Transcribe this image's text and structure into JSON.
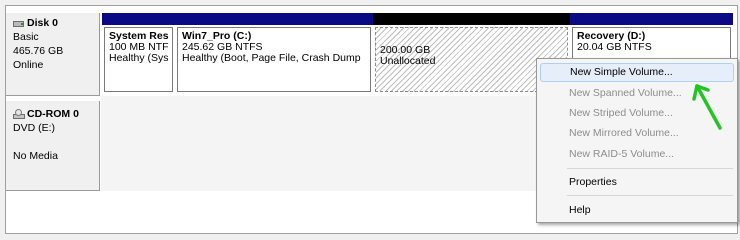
{
  "disk0": {
    "title": "Disk 0",
    "type": "Basic",
    "size": "465.76 GB",
    "status": "Online",
    "partitions": [
      {
        "name": "System Res",
        "size": "100 MB NTF",
        "status": "Healthy (Sys",
        "bar_color": "#0a0a84"
      },
      {
        "name": "Win7_Pro  (C:)",
        "size": "245.62 GB NTFS",
        "status": "Healthy (Boot, Page File, Crash Dump",
        "bar_color": "#0a0a84"
      },
      {
        "size": "200.00 GB",
        "status": "Unallocated",
        "bar_color": "#000000"
      },
      {
        "name": "Recovery  (D:)",
        "size": "20.04 GB NTFS",
        "bar_color": "#0a0a84"
      }
    ]
  },
  "cdrom0": {
    "title": "CD-ROM 0",
    "type": "DVD (E:)",
    "status": "No Media"
  },
  "context_menu": {
    "items": [
      {
        "label": "New Simple Volume...",
        "enabled": true,
        "highlighted": true
      },
      {
        "label": "New Spanned Volume...",
        "enabled": false
      },
      {
        "label": "New Striped Volume...",
        "enabled": false
      },
      {
        "label": "New Mirrored Volume...",
        "enabled": false
      },
      {
        "label": "New RAID-5 Volume...",
        "enabled": false
      },
      {
        "label": "Properties",
        "enabled": true
      },
      {
        "label": "Help",
        "enabled": true
      }
    ]
  },
  "annotation": {
    "arrow_color": "#22c522"
  }
}
